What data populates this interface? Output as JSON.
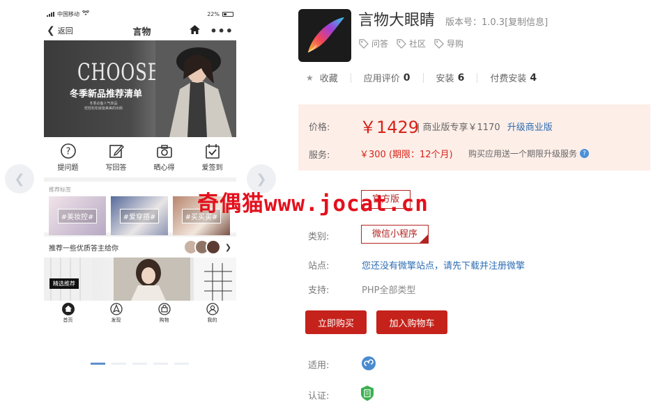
{
  "phone": {
    "status": {
      "carrier": "中国移动",
      "battery": "22%"
    },
    "nav": {
      "back": "返回",
      "title": "言物"
    },
    "banner": {
      "choose": "CHOOSE",
      "title": "冬季新品推荐清单",
      "sub1": "冬季必备人气单品",
      "sub2": "轻轻松松就能美美的出街"
    },
    "quick": [
      "提问题",
      "写回答",
      "晒心得",
      "爱签到"
    ],
    "tags_title": "推荐标签",
    "tags": [
      "#美妆控#",
      "#爱穿搭#",
      "#买买买#"
    ],
    "recommend": "推荐一些优质答主给你",
    "feature_badge": "精选推荐",
    "tabs": [
      "首页",
      "发现",
      "购物",
      "我的"
    ]
  },
  "app": {
    "name": "言物大眼睛",
    "version": "版本号：1.0.3[复制信息]",
    "tags": [
      "问答",
      "社区",
      "导购"
    ],
    "stats": {
      "fav_label": "收藏",
      "review_label": "应用评价",
      "review_count": "0",
      "install_label": "安装",
      "install_count": "6",
      "paid_label": "付费安装",
      "paid_count": "4"
    },
    "price": {
      "label": "价格:",
      "amount": "￥1429",
      "commercial": "| 商业版专享￥1170",
      "upgrade": "升级商业版",
      "service_label": "服务:",
      "service": "￥300 (期限：12个月)",
      "service_note": "购买应用送一个期限升级服务"
    },
    "fields": {
      "version_option": "官方版",
      "category_label": "类别:",
      "category": "微信小程序",
      "site_label": "站点:",
      "site": "您还没有微擎站点，请先下载并注册微擎",
      "support_label": "支持:",
      "support": "PHP全部类型",
      "apply_label": "适用:",
      "cert_label": "认证:"
    },
    "buttons": {
      "buy": "立即购买",
      "cart": "加入购物车"
    }
  },
  "watermark": {
    "head": "奇偶猫",
    "tail": "www.jocat.cn"
  },
  "colors": {
    "accent": "#c5221b",
    "price": "#d6231a",
    "link": "#2e6db3",
    "price_bg": "#fdeee8"
  }
}
